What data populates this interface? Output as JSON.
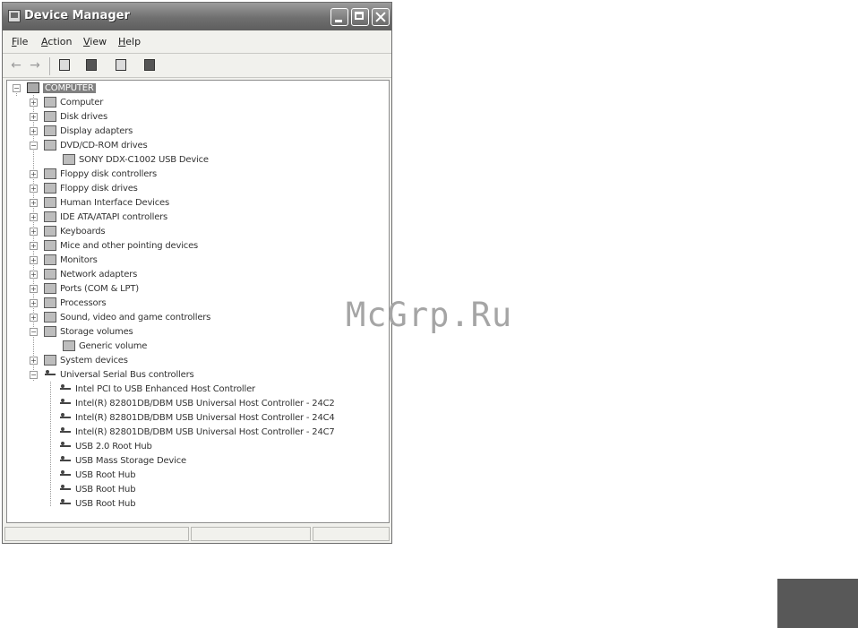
{
  "window": {
    "title": "Device Manager"
  },
  "menubar": {
    "items": [
      {
        "first": "F",
        "rest": "ile"
      },
      {
        "first": "A",
        "rest": "ction"
      },
      {
        "first": "V",
        "rest": "iew"
      },
      {
        "first": "H",
        "rest": "elp"
      }
    ]
  },
  "toolbar": {
    "back_icon": "back-arrow-icon",
    "forward_icon": "forward-arrow-icon",
    "buttons": [
      "properties-icon",
      "print-icon",
      "help-icon",
      "scan-hardware-icon"
    ]
  },
  "tree": {
    "root": "COMPUTER",
    "nodes": [
      "Computer",
      "Disk drives",
      "Display adapters",
      "DVD/CD-ROM drives",
      "SONY DDX-C1002 USB Device",
      "Floppy disk controllers",
      "Floppy disk drives",
      "Human Interface Devices",
      "IDE ATA/ATAPI controllers",
      "Keyboards",
      "Mice and other pointing devices",
      "Monitors",
      "Network adapters",
      "Ports (COM & LPT)",
      "Processors",
      "Sound, video and game controllers",
      "Storage volumes",
      "Generic volume",
      "System devices",
      "Universal Serial Bus controllers",
      "Intel PCI to USB Enhanced Host Controller",
      "Intel(R) 82801DB/DBM USB Universal Host Controller - 24C2",
      "Intel(R) 82801DB/DBM USB Universal Host Controller - 24C4",
      "Intel(R) 82801DB/DBM USB Universal Host Controller - 24C7",
      "USB 2.0 Root Hub",
      "USB Mass Storage Device",
      "USB Root Hub",
      "USB Root Hub",
      "USB Root Hub"
    ]
  },
  "watermark": "McGrp.Ru"
}
